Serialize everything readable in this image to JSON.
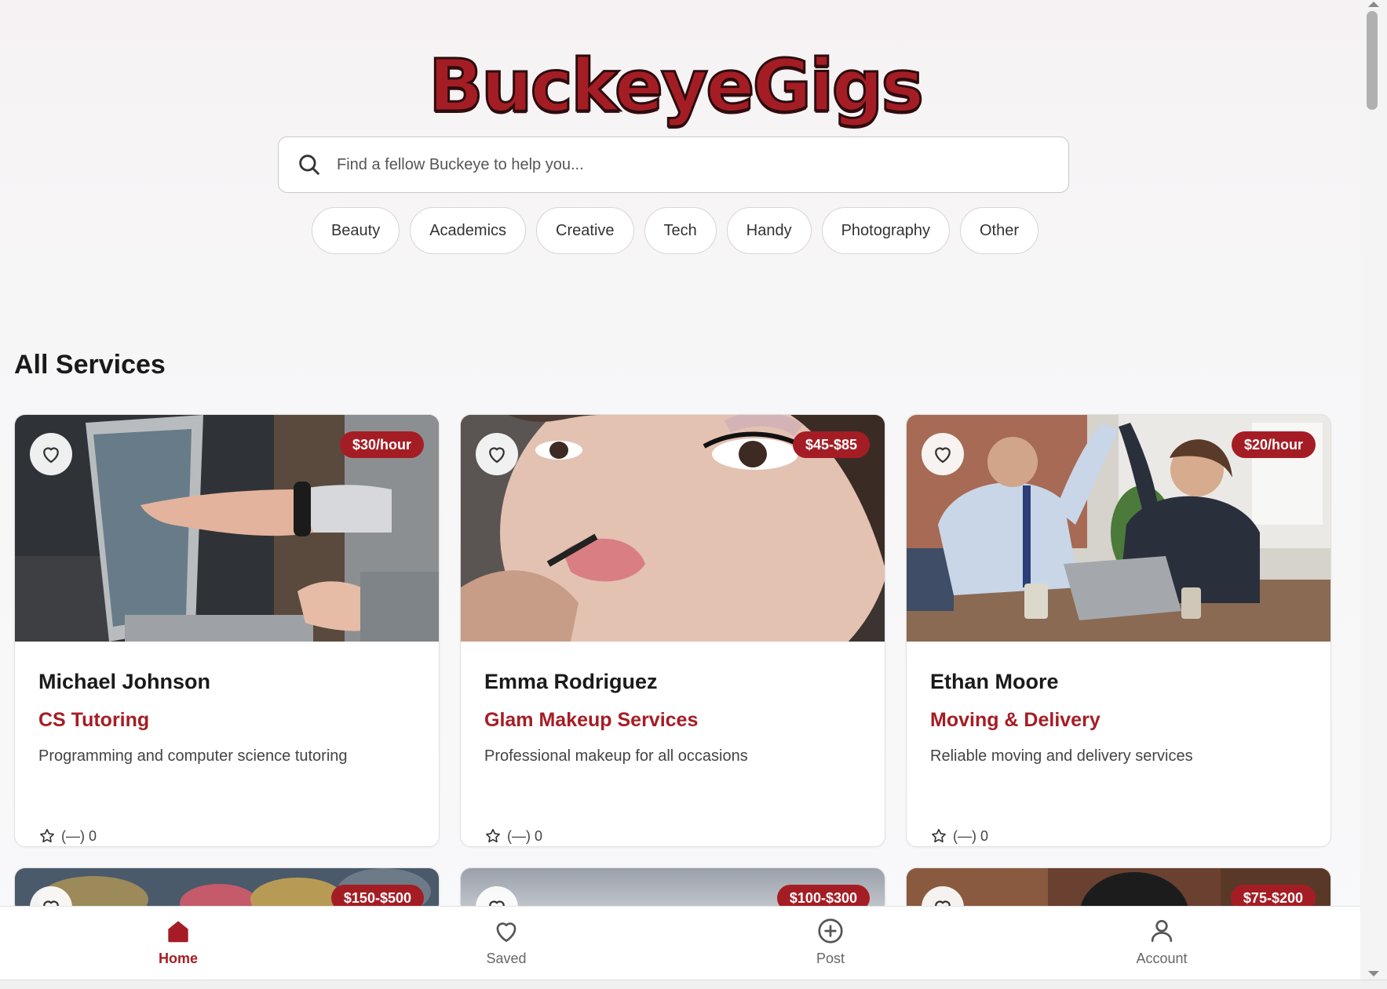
{
  "app": {
    "title": "BuckeyeGigs"
  },
  "search": {
    "placeholder": "Find a fellow Buckeye to help you..."
  },
  "categories": [
    "Beauty",
    "Academics",
    "Creative",
    "Tech",
    "Handy",
    "Photography",
    "Other"
  ],
  "section_title": "All Services",
  "colors": {
    "accent": "#a51d24",
    "text": "#1a1a1a"
  },
  "services": [
    {
      "name": "Michael Johnson",
      "service": "CS Tutoring",
      "description": "Programming and computer science tutoring",
      "price": "$30/hour",
      "rating": "(—) 0",
      "image": "laptop-pointing-photo"
    },
    {
      "name": "Emma Rodriguez",
      "service": "Glam Makeup Services",
      "description": "Professional makeup for all occasions",
      "price": "$45-$85",
      "rating": "(—) 0",
      "image": "makeup-closeup-photo"
    },
    {
      "name": "Ethan Moore",
      "service": "Moving & Delivery",
      "description": "Reliable moving and delivery services",
      "price": "$20/hour",
      "rating": "(—) 0",
      "image": "office-high-five-photo"
    },
    {
      "price": "$150-$500",
      "image": "flowers-photo"
    },
    {
      "price": "$100-$300",
      "image": "grey-photo"
    },
    {
      "price": "$75-$200",
      "image": "portrait-photo"
    }
  ],
  "nav": [
    {
      "label": "Home",
      "icon": "home-icon",
      "active": true
    },
    {
      "label": "Saved",
      "icon": "heart-icon",
      "active": false
    },
    {
      "label": "Post",
      "icon": "plus-circle-icon",
      "active": false
    },
    {
      "label": "Account",
      "icon": "person-icon",
      "active": false
    }
  ]
}
